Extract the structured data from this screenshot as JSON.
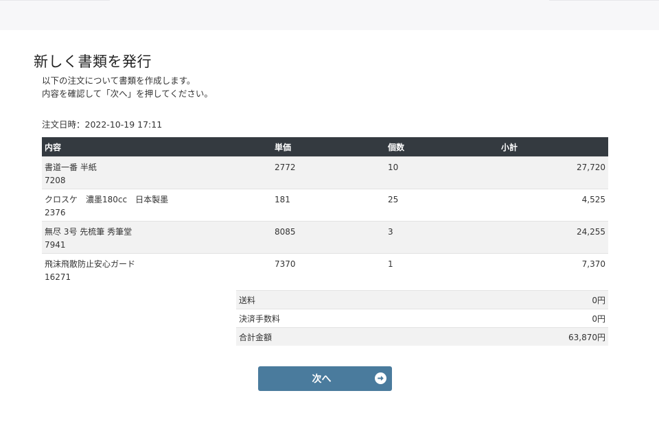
{
  "page": {
    "title": "新しく書類を発行",
    "intro_line1": "以下の注文について書類を作成します。",
    "intro_line2": "内容を確認して「次へ」を押してください。",
    "order_date": "注文日時：2022-10-19 17:11"
  },
  "table": {
    "headers": {
      "name": "内容",
      "price": "単価",
      "qty": "個数",
      "subtotal": "小計"
    },
    "rows": [
      {
        "name": "書道一番 半紙",
        "code": "7208",
        "price": "2772",
        "qty": "10",
        "subtotal": "27,720"
      },
      {
        "name": "クロスケ　濃墨180cc　日本製墨",
        "code": "2376",
        "price": "181",
        "qty": "25",
        "subtotal": "4,525"
      },
      {
        "name": "無尽 3号 先梳筆 秀筆堂",
        "code": "7941",
        "price": "8085",
        "qty": "3",
        "subtotal": "24,255"
      },
      {
        "name": "飛沫飛散防止安心ガード",
        "code": "16271",
        "price": "7370",
        "qty": "1",
        "subtotal": "7,370"
      }
    ]
  },
  "summary": {
    "shipping_label": "送料",
    "shipping_value": "0円",
    "fee_label": "決済手数料",
    "fee_value": "0円",
    "total_label": "合計金額",
    "total_value": "63,870円"
  },
  "next_button": {
    "label": "次へ",
    "icon": "arrow-circle-right-icon"
  },
  "colors": {
    "header_bg": "#343a40",
    "button_bg": "#4a7b9d",
    "stripe": "#f2f2f2"
  }
}
